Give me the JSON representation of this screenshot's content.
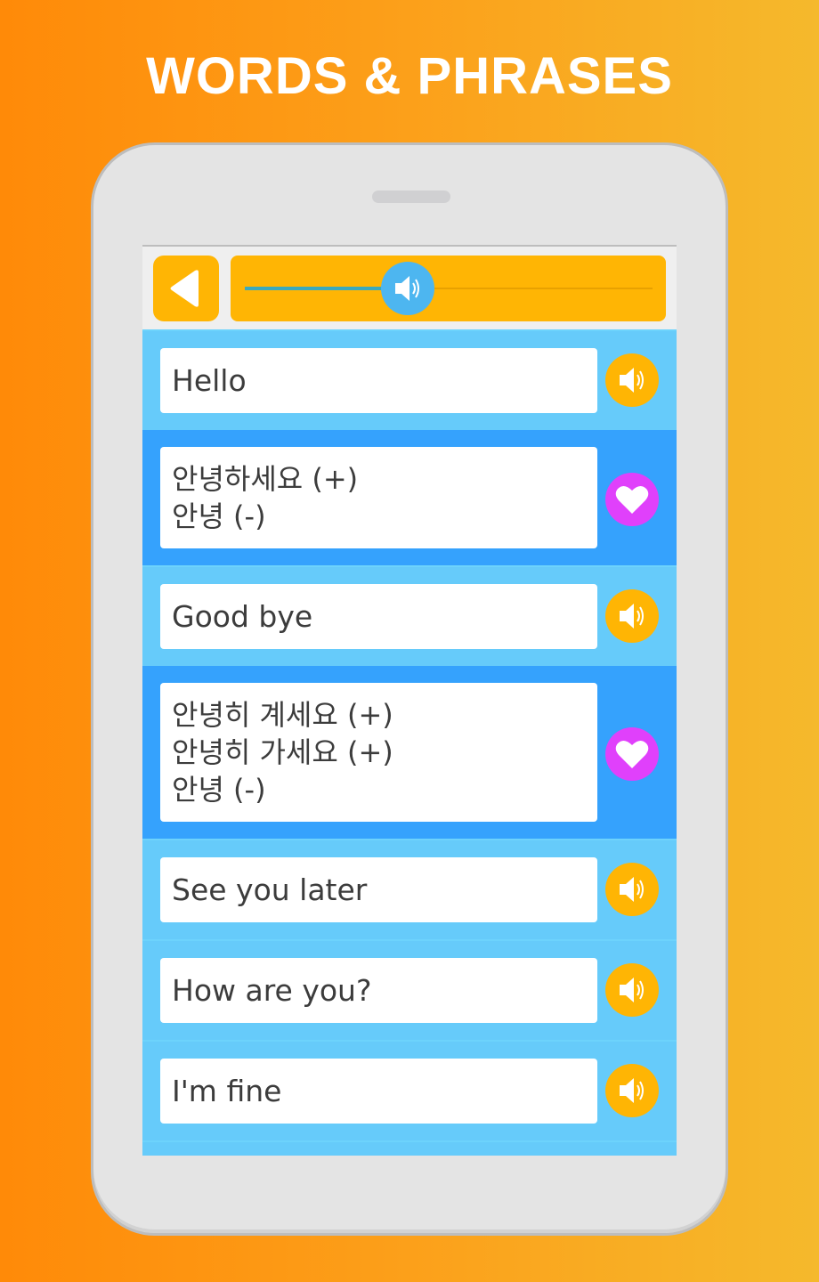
{
  "headline": "WORDS & PHRASES",
  "colors": {
    "accent_orange": "#FFB504",
    "row_light_blue": "#66CBFA",
    "row_dark_blue": "#35A2FD",
    "favorite_magenta": "#E040FB",
    "slider_thumb_blue": "#4DB6F0"
  },
  "toolbar": {
    "back_icon": "back-triangle-icon",
    "volume_slider": {
      "icon": "speaker-icon",
      "value_percent": 40
    }
  },
  "phrases": [
    {
      "type": "english",
      "text": "Hello",
      "action_icon": "speaker-icon"
    },
    {
      "type": "korean",
      "lines": [
        "안녕하세요 (+)",
        "안녕 (-)"
      ],
      "action_icon": "heart-icon"
    },
    {
      "type": "english",
      "text": "Good bye",
      "action_icon": "speaker-icon"
    },
    {
      "type": "korean",
      "lines": [
        "안녕히 계세요 (+)",
        "안녕히 가세요 (+)",
        "안녕 (-)"
      ],
      "action_icon": "heart-icon"
    },
    {
      "type": "english",
      "text": "See you later",
      "action_icon": "speaker-icon"
    },
    {
      "type": "english",
      "text": "How are you?",
      "action_icon": "speaker-icon"
    },
    {
      "type": "english",
      "text": "I'm fine",
      "action_icon": "speaker-icon"
    }
  ]
}
